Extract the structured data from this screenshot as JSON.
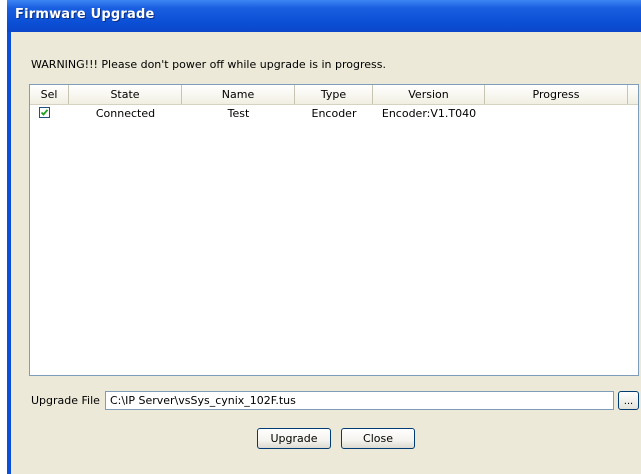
{
  "window": {
    "title": "Firmware Upgrade"
  },
  "warning_text": "WARNING!!!  Please don't power off while upgrade is in progress.",
  "table": {
    "columns": [
      "Sel",
      "State",
      "Name",
      "Type",
      "Version",
      "Progress"
    ],
    "rows": [
      {
        "sel": true,
        "state": "Connected",
        "name": "Test",
        "type": "Encoder",
        "version": "Encoder:V1.T040",
        "progress": ""
      }
    ]
  },
  "upgrade_file": {
    "label": "Upgrade File",
    "value": "C:\\IP Server\\vsSys_cynix_102F.tus",
    "browse_label": "..."
  },
  "buttons": {
    "upgrade": "Upgrade",
    "close": "Close"
  }
}
